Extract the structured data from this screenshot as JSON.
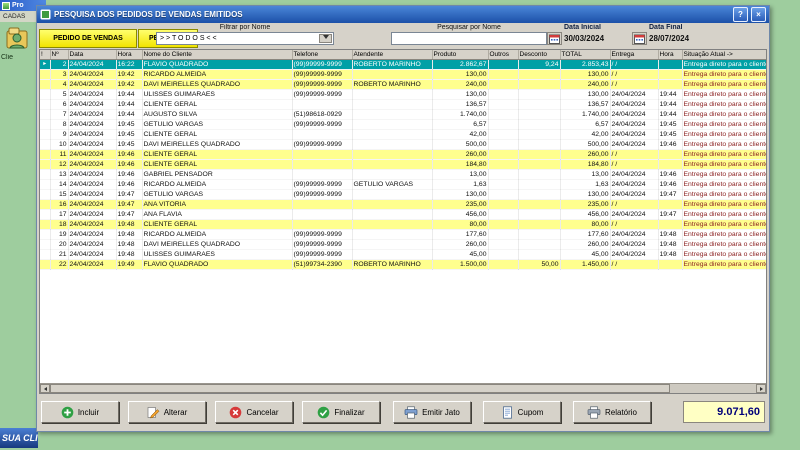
{
  "window": {
    "title": "PESQUISA DOS PEDIDOS DE VENDAS EMITIDOS",
    "help_glyph": "?",
    "close_glyph": "×"
  },
  "toolbar": {
    "pedido_button": "PEDIDO DE VENDAS",
    "pendente_button": "PENDENTE",
    "filter_label": "Filtrar por Nome",
    "filter_value": "> > T O D O S < <",
    "search_label": "Pesquisar por Nome",
    "search_value": "",
    "date_start_label": "Data Inicial",
    "date_start_value": "30/03/2024",
    "date_end_label": "Data Final",
    "date_end_value": "28/07/2024"
  },
  "grid": {
    "columns": [
      "!",
      "Nº",
      "Data",
      "Hora",
      "Nome do Cliente",
      "Telefone",
      "Atendente",
      "Produto",
      "Outros",
      "Desconto",
      "TOTAL",
      "Entrega",
      "Hora",
      "Situação Atual ->"
    ],
    "rows": [
      {
        "selected": true,
        "num": "2",
        "data": "24/04/2024",
        "hora": "16:22",
        "nome": "FLAVIO QUADRADO",
        "telefone": "(99)99999-9999",
        "atendente": "ROBERTO MARINHO",
        "produto": "2.862,67",
        "outros": "",
        "desconto": "9,24",
        "total": "2.853,43",
        "entrega": "/ /",
        "entrega_hora": "",
        "situacao": "Entrega direto para o cliente"
      },
      {
        "num": "3",
        "data": "24/04/2024",
        "hora": "19:42",
        "nome": "RICARDO ALMEIDA",
        "telefone": "(99)99999-9999",
        "atendente": "",
        "produto": "130,00",
        "outros": "",
        "desconto": "",
        "total": "130,00",
        "entrega": "/ /",
        "entrega_hora": "",
        "situacao": "Entrega direto para o cliente"
      },
      {
        "num": "4",
        "data": "24/04/2024",
        "hora": "19:42",
        "nome": "DAVI MEIRELLES QUADRADO",
        "telefone": "(99)99999-9999",
        "atendente": "ROBERTO MARINHO",
        "produto": "240,00",
        "outros": "",
        "desconto": "",
        "total": "240,00",
        "entrega": "/ /",
        "entrega_hora": "",
        "situacao": "Entrega direto para o cliente"
      },
      {
        "num": "5",
        "data": "24/04/2024",
        "hora": "19:44",
        "nome": "ULISSES GUIMARAES",
        "telefone": "(99)99999-9999",
        "atendente": "",
        "produto": "130,00",
        "outros": "",
        "desconto": "",
        "total": "130,00",
        "entrega": "24/04/2024",
        "entrega_hora": "19:44",
        "situacao": "Entrega direto para o cliente"
      },
      {
        "num": "6",
        "data": "24/04/2024",
        "hora": "19:44",
        "nome": "CLIENTE GERAL",
        "telefone": "",
        "atendente": "",
        "produto": "136,57",
        "outros": "",
        "desconto": "",
        "total": "136,57",
        "entrega": "24/04/2024",
        "entrega_hora": "19:44",
        "situacao": "Entrega direto para o cliente"
      },
      {
        "num": "7",
        "data": "24/04/2024",
        "hora": "19:44",
        "nome": "AUGUSTO SILVA",
        "telefone": "(51)98618-0929",
        "atendente": "",
        "produto": "1.740,00",
        "outros": "",
        "desconto": "",
        "total": "1.740,00",
        "entrega": "24/04/2024",
        "entrega_hora": "19:44",
        "situacao": "Entrega direto para o cliente"
      },
      {
        "num": "8",
        "data": "24/04/2024",
        "hora": "19:45",
        "nome": "GETULIO VARGAS",
        "telefone": "(99)99999-9999",
        "atendente": "",
        "produto": "6,57",
        "outros": "",
        "desconto": "",
        "total": "6,57",
        "entrega": "24/04/2024",
        "entrega_hora": "19:45",
        "situacao": "Entrega direto para o cliente"
      },
      {
        "num": "9",
        "data": "24/04/2024",
        "hora": "19:45",
        "nome": "CLIENTE GERAL",
        "telefone": "",
        "atendente": "",
        "produto": "42,00",
        "outros": "",
        "desconto": "",
        "total": "42,00",
        "entrega": "24/04/2024",
        "entrega_hora": "19:45",
        "situacao": "Entrega direto para o cliente"
      },
      {
        "num": "10",
        "data": "24/04/2024",
        "hora": "19:45",
        "nome": "DAVI MEIRELLES QUADRADO",
        "telefone": "(99)99999-9999",
        "atendente": "",
        "produto": "500,00",
        "outros": "",
        "desconto": "",
        "total": "500,00",
        "entrega": "24/04/2024",
        "entrega_hora": "19:46",
        "situacao": "Entrega direto para o cliente"
      },
      {
        "num": "11",
        "data": "24/04/2024",
        "hora": "19:46",
        "nome": "CLIENTE GERAL",
        "telefone": "",
        "atendente": "",
        "produto": "260,00",
        "outros": "",
        "desconto": "",
        "total": "260,00",
        "entrega": "/ /",
        "entrega_hora": "",
        "situacao": "Entrega direto para o cliente"
      },
      {
        "num": "12",
        "data": "24/04/2024",
        "hora": "19:46",
        "nome": "CLIENTE GERAL",
        "telefone": "",
        "atendente": "",
        "produto": "184,80",
        "outros": "",
        "desconto": "",
        "total": "184,80",
        "entrega": "/ /",
        "entrega_hora": "",
        "situacao": "Entrega direto para o cliente"
      },
      {
        "num": "13",
        "data": "24/04/2024",
        "hora": "19:46",
        "nome": "GABRIEL PENSADOR",
        "telefone": "",
        "atendente": "",
        "produto": "13,00",
        "outros": "",
        "desconto": "",
        "total": "13,00",
        "entrega": "24/04/2024",
        "entrega_hora": "19:46",
        "situacao": "Entrega direto para o cliente"
      },
      {
        "num": "14",
        "data": "24/04/2024",
        "hora": "19:46",
        "nome": "RICARDO ALMEIDA",
        "telefone": "(99)99999-9999",
        "atendente": "GETULIO VARGAS",
        "produto": "1,63",
        "outros": "",
        "desconto": "",
        "total": "1,63",
        "entrega": "24/04/2024",
        "entrega_hora": "19:46",
        "situacao": "Entrega direto para o cliente"
      },
      {
        "num": "15",
        "data": "24/04/2024",
        "hora": "19:47",
        "nome": "GETULIO VARGAS",
        "telefone": "(99)99999-9999",
        "atendente": "",
        "produto": "130,00",
        "outros": "",
        "desconto": "",
        "total": "130,00",
        "entrega": "24/04/2024",
        "entrega_hora": "19:47",
        "situacao": "Entrega direto para o cliente"
      },
      {
        "num": "16",
        "data": "24/04/2024",
        "hora": "19:47",
        "nome": "ANA VITORIA",
        "telefone": "",
        "atendente": "",
        "produto": "235,00",
        "outros": "",
        "desconto": "",
        "total": "235,00",
        "entrega": "/ /",
        "entrega_hora": "",
        "situacao": "Entrega direto para o cliente"
      },
      {
        "num": "17",
        "data": "24/04/2024",
        "hora": "19:47",
        "nome": "ANA FLAVIA",
        "telefone": "",
        "atendente": "",
        "produto": "456,00",
        "outros": "",
        "desconto": "",
        "total": "456,00",
        "entrega": "24/04/2024",
        "entrega_hora": "19:47",
        "situacao": "Entrega direto para o cliente"
      },
      {
        "num": "18",
        "data": "24/04/2024",
        "hora": "19:48",
        "nome": "CLIENTE GERAL",
        "telefone": "",
        "atendente": "",
        "produto": "80,00",
        "outros": "",
        "desconto": "",
        "total": "80,00",
        "entrega": "/ /",
        "entrega_hora": "",
        "situacao": "Entrega direto para o cliente"
      },
      {
        "num": "19",
        "data": "24/04/2024",
        "hora": "19:48",
        "nome": "RICARDO ALMEIDA",
        "telefone": "(99)99999-9999",
        "atendente": "",
        "produto": "177,60",
        "outros": "",
        "desconto": "",
        "total": "177,60",
        "entrega": "24/04/2024",
        "entrega_hora": "19:48",
        "situacao": "Entrega direto para o cliente"
      },
      {
        "num": "20",
        "data": "24/04/2024",
        "hora": "19:48",
        "nome": "DAVI MEIRELLES QUADRADO",
        "telefone": "(99)99999-9999",
        "atendente": "",
        "produto": "260,00",
        "outros": "",
        "desconto": "",
        "total": "260,00",
        "entrega": "24/04/2024",
        "entrega_hora": "19:48",
        "situacao": "Entrega direto para o cliente"
      },
      {
        "num": "21",
        "data": "24/04/2024",
        "hora": "19:48",
        "nome": "ULISSES GUIMARAES",
        "telefone": "(99)99999-9999",
        "atendente": "",
        "produto": "45,00",
        "outros": "",
        "desconto": "",
        "total": "45,00",
        "entrega": "24/04/2024",
        "entrega_hora": "19:48",
        "situacao": "Entrega direto para o cliente"
      },
      {
        "num": "22",
        "data": "24/04/2024",
        "hora": "19:49",
        "nome": "FLAVIO QUADRADO",
        "telefone": "(51)99734-2390",
        "atendente": "ROBERTO MARINHO",
        "produto": "1.500,00",
        "outros": "",
        "desconto": "50,00",
        "total": "1.450,00",
        "entrega": "/ /",
        "entrega_hora": "",
        "situacao": "Entrega direto para o cliente"
      }
    ]
  },
  "actions": [
    {
      "name": "incluir-button",
      "label": "Incluir",
      "icon": "add-icon"
    },
    {
      "name": "alterar-button",
      "label": "Alterar",
      "icon": "edit-icon"
    },
    {
      "name": "cancelar-button",
      "label": "Cancelar",
      "icon": "cancel-icon"
    },
    {
      "name": "finalizar-button",
      "label": "Finalizar",
      "icon": "finalize-icon"
    },
    {
      "name": "emitir-jato-button",
      "label": "Emitir Jato",
      "icon": "printer-icon"
    },
    {
      "name": "cupom-button",
      "label": "Cupom",
      "icon": "receipt-icon"
    },
    {
      "name": "relatorio-button",
      "label": "Relatório",
      "icon": "report-icon"
    }
  ],
  "footer": {
    "total": "9.071,60"
  },
  "bg": {
    "window_title_fragment": "Pro",
    "menu_fragment": "CADAS",
    "icon_caption_fragment": "Clie",
    "statusbar_fragment": "SUA CLI"
  },
  "colors": {
    "selected_row": "#00a0a6",
    "pending_row": "#ffff8e",
    "button_yellow": "#f2e400",
    "titlebar_blue": "#2f6bc4",
    "total_text": "#00007a",
    "situacao_text": "#8a1f1f",
    "desktop_green": "#9ecd9e"
  }
}
